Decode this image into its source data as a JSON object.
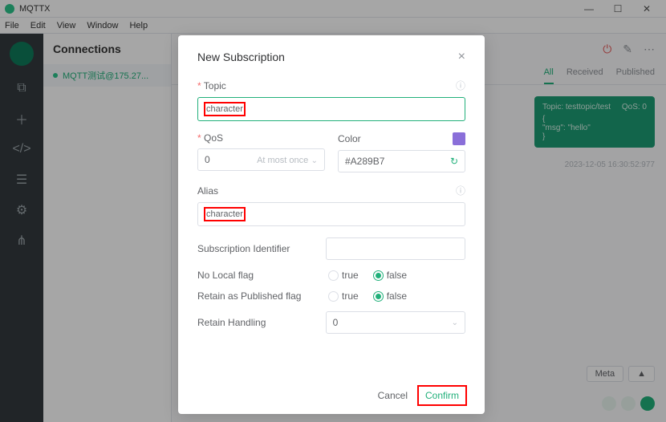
{
  "window": {
    "title": "MQTTX"
  },
  "menu": {
    "file": "File",
    "edit": "Edit",
    "view": "View",
    "window": "Window",
    "help": "Help"
  },
  "sidebar": {
    "heading": "Connections",
    "conn_label": "MQTT测试@175.27..."
  },
  "tabs": {
    "all": "All",
    "received": "Received",
    "published": "Published"
  },
  "message": {
    "topic_label": "Topic: testtopic/test",
    "qos_label": "QoS: 0",
    "body_open": "{",
    "body_line": "  \"msg\": \"hello\"",
    "body_close": "}",
    "timestamp": "2023-12-05 16:30:52:977"
  },
  "bottom": {
    "meta": "Meta",
    "caret": "▲"
  },
  "dialog": {
    "title": "New Subscription",
    "topic_label": "Topic",
    "topic_value": "character",
    "qos_label": "QoS",
    "qos_value": "0",
    "qos_sub": "At most once",
    "color_label": "Color",
    "color_value": "#A289B7",
    "alias_label": "Alias",
    "alias_value": "character",
    "subid_label": "Subscription Identifier",
    "nolocal_label": "No Local flag",
    "retainpub_label": "Retain as Published flag",
    "retainh_label": "Retain Handling",
    "retainh_value": "0",
    "true": "true",
    "false": "false",
    "cancel": "Cancel",
    "confirm": "Confirm"
  }
}
